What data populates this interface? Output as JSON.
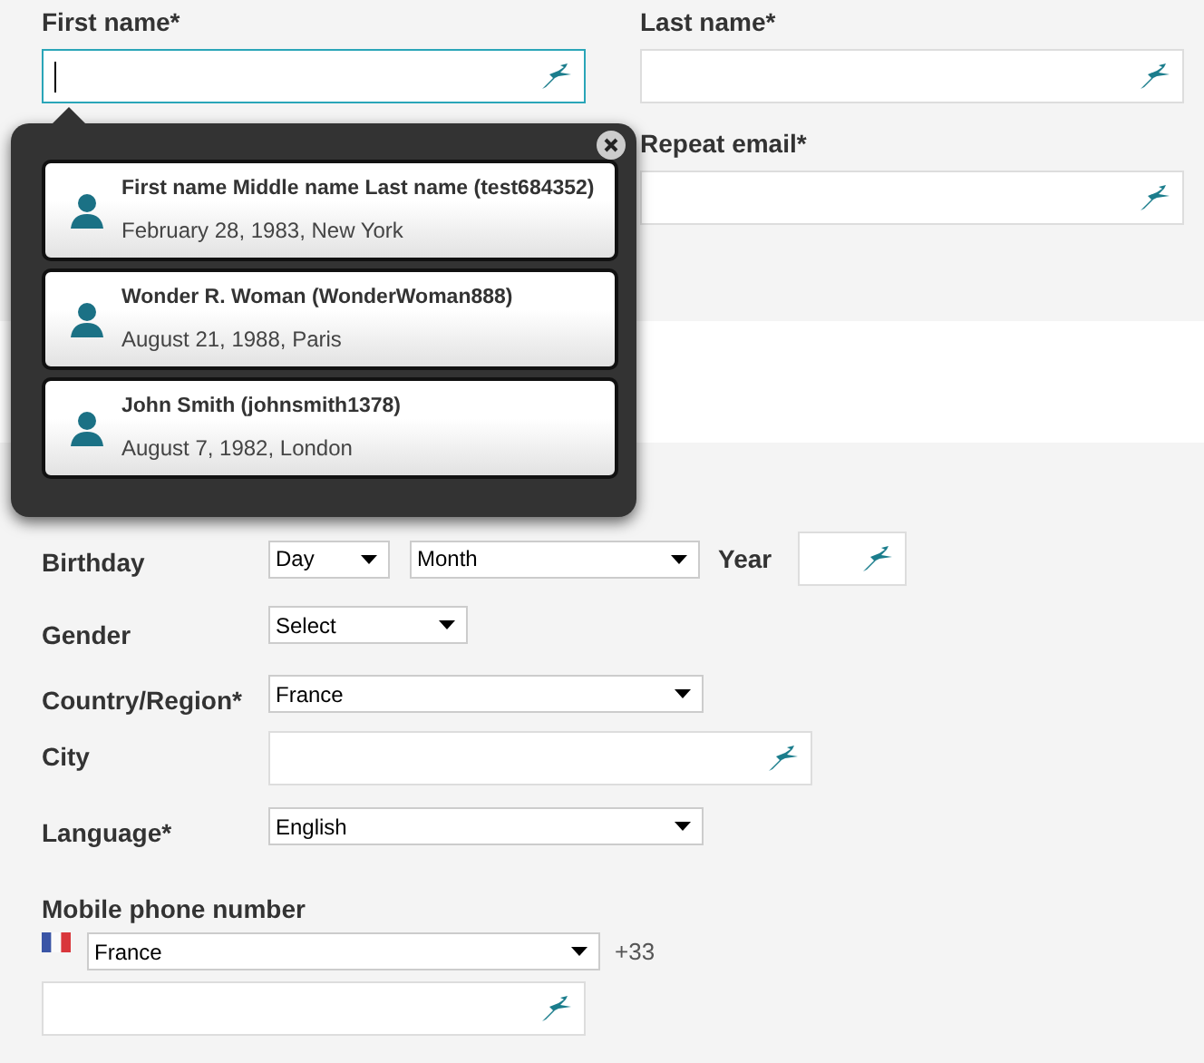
{
  "top_fields": [
    {
      "label": "First name*",
      "focused": true
    },
    {
      "label": "Last name*",
      "focused": false
    },
    {
      "label": "Repeat email*",
      "focused": false
    }
  ],
  "suggestions": [
    {
      "name": "First name Middle name Last name (test684352)",
      "details": "February 28, 1983, New York"
    },
    {
      "name": "Wonder R. Woman (WonderWoman888)",
      "details": "August 21, 1988, Paris"
    },
    {
      "name": "John Smith (johnsmith1378)",
      "details": "August 7, 1982, London"
    }
  ],
  "form_rows": [
    {
      "kind": "birthday",
      "label": "Birthday",
      "day": "Day",
      "month": "Month",
      "year_label": "Year"
    },
    {
      "kind": "compact-select",
      "label": "Gender",
      "value": "Select"
    },
    {
      "kind": "select",
      "label": "Country/Region*",
      "value": "France"
    },
    {
      "kind": "text",
      "label": "City"
    },
    {
      "kind": "select",
      "label": "Language*",
      "value": "English"
    }
  ],
  "mobile": {
    "label": "Mobile phone number",
    "country": "France",
    "code": "+33"
  }
}
